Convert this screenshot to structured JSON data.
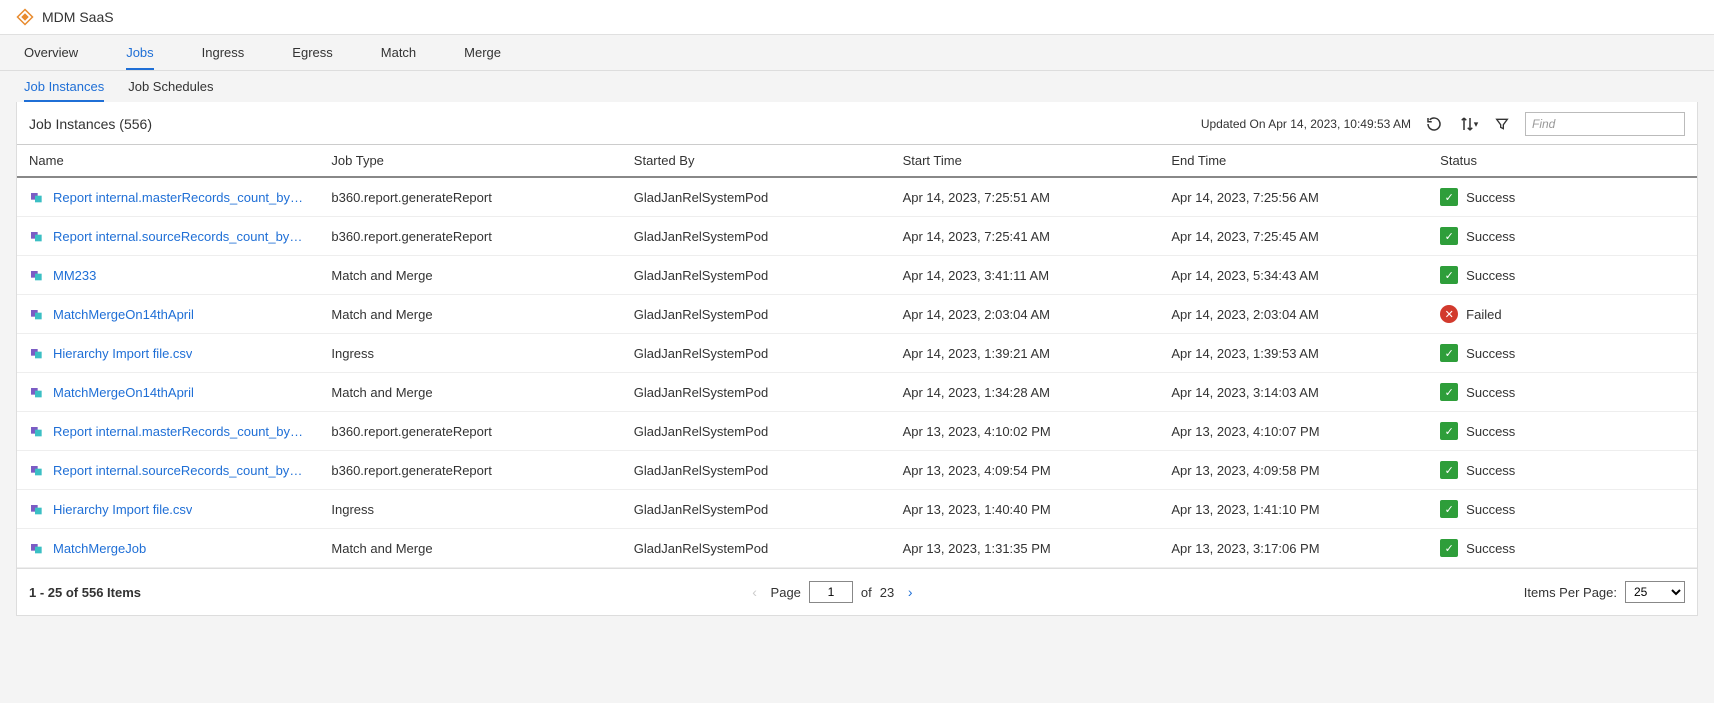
{
  "header": {
    "title": "MDM SaaS"
  },
  "nav": {
    "tabs": [
      "Overview",
      "Jobs",
      "Ingress",
      "Egress",
      "Match",
      "Merge"
    ],
    "active": "Jobs"
  },
  "subnav": {
    "tabs": [
      "Job Instances",
      "Job Schedules"
    ],
    "active": "Job Instances"
  },
  "panel": {
    "title_prefix": "Job Instances",
    "count": "556",
    "updated_on": "Updated On Apr 14, 2023, 10:49:53 AM",
    "find_placeholder": "Find"
  },
  "columns": [
    "Name",
    "Job Type",
    "Started By",
    "Start Time",
    "End Time",
    "Status"
  ],
  "rows": [
    {
      "name": "Report internal.masterRecords_count_by_BE",
      "jobType": "b360.report.generateReport",
      "startedBy": "GladJanRelSystemPod",
      "startTime": "Apr 14, 2023, 7:25:51 AM",
      "endTime": "Apr 14, 2023, 7:25:56 AM",
      "status": "Success"
    },
    {
      "name": "Report internal.sourceRecords_count_by_BE",
      "jobType": "b360.report.generateReport",
      "startedBy": "GladJanRelSystemPod",
      "startTime": "Apr 14, 2023, 7:25:41 AM",
      "endTime": "Apr 14, 2023, 7:25:45 AM",
      "status": "Success"
    },
    {
      "name": "MM233",
      "jobType": "Match and Merge",
      "startedBy": "GladJanRelSystemPod",
      "startTime": "Apr 14, 2023, 3:41:11 AM",
      "endTime": "Apr 14, 2023, 5:34:43 AM",
      "status": "Success"
    },
    {
      "name": "MatchMergeOn14thApril",
      "jobType": "Match and Merge",
      "startedBy": "GladJanRelSystemPod",
      "startTime": "Apr 14, 2023, 2:03:04 AM",
      "endTime": "Apr 14, 2023, 2:03:04 AM",
      "status": "Failed"
    },
    {
      "name": "Hierarchy Import file.csv",
      "jobType": "Ingress",
      "startedBy": "GladJanRelSystemPod",
      "startTime": "Apr 14, 2023, 1:39:21 AM",
      "endTime": "Apr 14, 2023, 1:39:53 AM",
      "status": "Success"
    },
    {
      "name": "MatchMergeOn14thApril",
      "jobType": "Match and Merge",
      "startedBy": "GladJanRelSystemPod",
      "startTime": "Apr 14, 2023, 1:34:28 AM",
      "endTime": "Apr 14, 2023, 3:14:03 AM",
      "status": "Success"
    },
    {
      "name": "Report internal.masterRecords_count_by_BE",
      "jobType": "b360.report.generateReport",
      "startedBy": "GladJanRelSystemPod",
      "startTime": "Apr 13, 2023, 4:10:02 PM",
      "endTime": "Apr 13, 2023, 4:10:07 PM",
      "status": "Success"
    },
    {
      "name": "Report internal.sourceRecords_count_by_BE",
      "jobType": "b360.report.generateReport",
      "startedBy": "GladJanRelSystemPod",
      "startTime": "Apr 13, 2023, 4:09:54 PM",
      "endTime": "Apr 13, 2023, 4:09:58 PM",
      "status": "Success"
    },
    {
      "name": "Hierarchy Import file.csv",
      "jobType": "Ingress",
      "startedBy": "GladJanRelSystemPod",
      "startTime": "Apr 13, 2023, 1:40:40 PM",
      "endTime": "Apr 13, 2023, 1:41:10 PM",
      "status": "Success"
    },
    {
      "name": "MatchMergeJob",
      "jobType": "Match and Merge",
      "startedBy": "GladJanRelSystemPod",
      "startTime": "Apr 13, 2023, 1:31:35 PM",
      "endTime": "Apr 13, 2023, 3:17:06 PM",
      "status": "Success"
    }
  ],
  "pager": {
    "summary": "1 - 25 of 556 Items",
    "page_label": "Page",
    "page_value": "1",
    "of_label": "of",
    "total_pages": "23",
    "ipp_label": "Items Per Page:",
    "ipp_value": "25"
  }
}
